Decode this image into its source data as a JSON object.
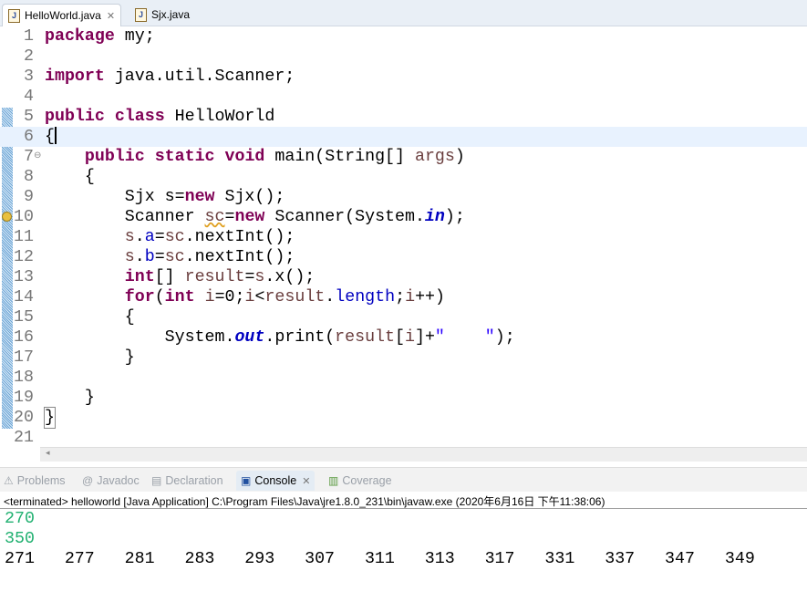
{
  "editor_tabs": [
    {
      "label": "HelloWorld.java",
      "active": true,
      "closable": true
    },
    {
      "label": "Sjx.java",
      "active": false
    }
  ],
  "code": [
    [
      [
        "package",
        "kw"
      ],
      [
        " my;",
        ""
      ]
    ],
    [],
    [
      [
        "import",
        "kw"
      ],
      [
        " java.util.Scanner;",
        ""
      ]
    ],
    [],
    [
      [
        "public",
        "kw"
      ],
      [
        " ",
        ""
      ],
      [
        "class",
        "kw"
      ],
      [
        " HelloWorld",
        ""
      ]
    ],
    [
      [
        "{",
        ""
      ]
    ],
    [
      [
        "    ",
        ""
      ],
      [
        "public",
        "kw"
      ],
      [
        " ",
        ""
      ],
      [
        "static",
        "kw"
      ],
      [
        " ",
        ""
      ],
      [
        "void",
        "kw"
      ],
      [
        " main(String[] ",
        ""
      ],
      [
        "args",
        "local"
      ],
      [
        ")",
        ""
      ]
    ],
    [
      [
        "    {",
        ""
      ]
    ],
    [
      [
        "        Sjx s=",
        ""
      ],
      [
        "new",
        "kw"
      ],
      [
        " Sjx();",
        ""
      ]
    ],
    [
      [
        "        Scanner ",
        ""
      ],
      [
        "sc",
        "local warn"
      ],
      [
        "=",
        ""
      ],
      [
        "new",
        "kw"
      ],
      [
        " Scanner(System.",
        ""
      ],
      [
        "in",
        "sfield"
      ],
      [
        ");",
        ""
      ]
    ],
    [
      [
        "        ",
        ""
      ],
      [
        "s",
        "local"
      ],
      [
        ".",
        ""
      ],
      [
        "a",
        "field"
      ],
      [
        "=",
        ""
      ],
      [
        "sc",
        "local"
      ],
      [
        ".nextInt();",
        ""
      ]
    ],
    [
      [
        "        ",
        ""
      ],
      [
        "s",
        "local"
      ],
      [
        ".",
        ""
      ],
      [
        "b",
        "field"
      ],
      [
        "=",
        ""
      ],
      [
        "sc",
        "local"
      ],
      [
        ".nextInt();",
        ""
      ]
    ],
    [
      [
        "        ",
        ""
      ],
      [
        "int",
        "kw"
      ],
      [
        "[] ",
        ""
      ],
      [
        "result",
        "local"
      ],
      [
        "=",
        ""
      ],
      [
        "s",
        "local"
      ],
      [
        ".x();",
        ""
      ]
    ],
    [
      [
        "        ",
        ""
      ],
      [
        "for",
        "kw"
      ],
      [
        "(",
        ""
      ],
      [
        "int",
        "kw"
      ],
      [
        " ",
        ""
      ],
      [
        "i",
        "local"
      ],
      [
        "=0;",
        ""
      ],
      [
        "i",
        "local"
      ],
      [
        "<",
        ""
      ],
      [
        "result",
        "local"
      ],
      [
        ".",
        ""
      ],
      [
        "length",
        "field"
      ],
      [
        ";",
        ""
      ],
      [
        "i",
        "local"
      ],
      [
        "++)",
        ""
      ]
    ],
    [
      [
        "        {",
        ""
      ]
    ],
    [
      [
        "            System.",
        ""
      ],
      [
        "out",
        "sfield"
      ],
      [
        ".print(",
        ""
      ],
      [
        "result",
        "local"
      ],
      [
        "[",
        ""
      ],
      [
        "i",
        "local"
      ],
      [
        "]+",
        ""
      ],
      [
        "\"    \"",
        "str"
      ],
      [
        ");",
        ""
      ]
    ],
    [
      [
        "        }",
        ""
      ]
    ],
    [],
    [
      [
        "    }",
        ""
      ]
    ],
    [
      [
        "}",
        ""
      ]
    ],
    []
  ],
  "current_line": 6,
  "panel_tabs": [
    {
      "label": "Problems",
      "icon": "problems-icon"
    },
    {
      "label": "Javadoc",
      "icon": "at-icon"
    },
    {
      "label": "Declaration",
      "icon": "declaration-icon"
    },
    {
      "label": "Console",
      "icon": "console-icon",
      "active": true
    },
    {
      "label": "Coverage",
      "icon": "coverage-icon"
    }
  ],
  "console": {
    "status": "<terminated> helloworld [Java Application] C:\\Program Files\\Java\\jre1.8.0_231\\bin\\javaw.exe (2020年6月16日 下午11:38:06)",
    "input": [
      "270",
      "350"
    ],
    "output": "271   277   281   283   293   307   311   313   317   331   337   347   349"
  },
  "colors": {
    "keyword": "#7f0055",
    "field": "#0000c0",
    "string": "#2a00ff",
    "local": "#6a3e3e",
    "console_input": "#20b070"
  }
}
